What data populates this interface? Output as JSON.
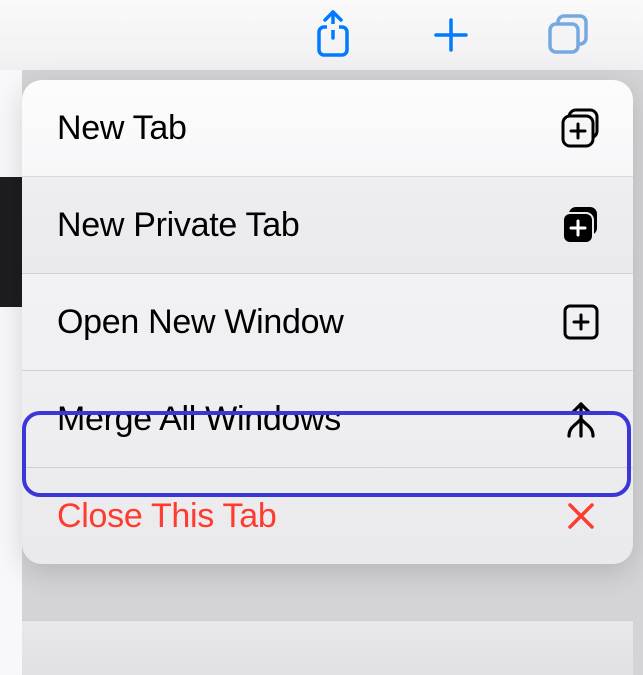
{
  "colors": {
    "accent": "#007aff",
    "danger": "#ff3b30",
    "highlight": "#3a36d8"
  },
  "toolbar": {
    "share_icon": "share-icon",
    "add_icon": "plus-icon",
    "tabs_icon": "tabs-icon"
  },
  "menu": {
    "items": [
      {
        "label": "New Tab",
        "icon": "tab-plus-icon"
      },
      {
        "label": "New Private Tab",
        "icon": "tab-plus-filled-icon"
      },
      {
        "label": "Open New Window",
        "icon": "window-plus-icon"
      },
      {
        "label": "Merge All Windows",
        "icon": "merge-icon"
      },
      {
        "label": "Close This Tab",
        "icon": "close-icon"
      }
    ]
  }
}
